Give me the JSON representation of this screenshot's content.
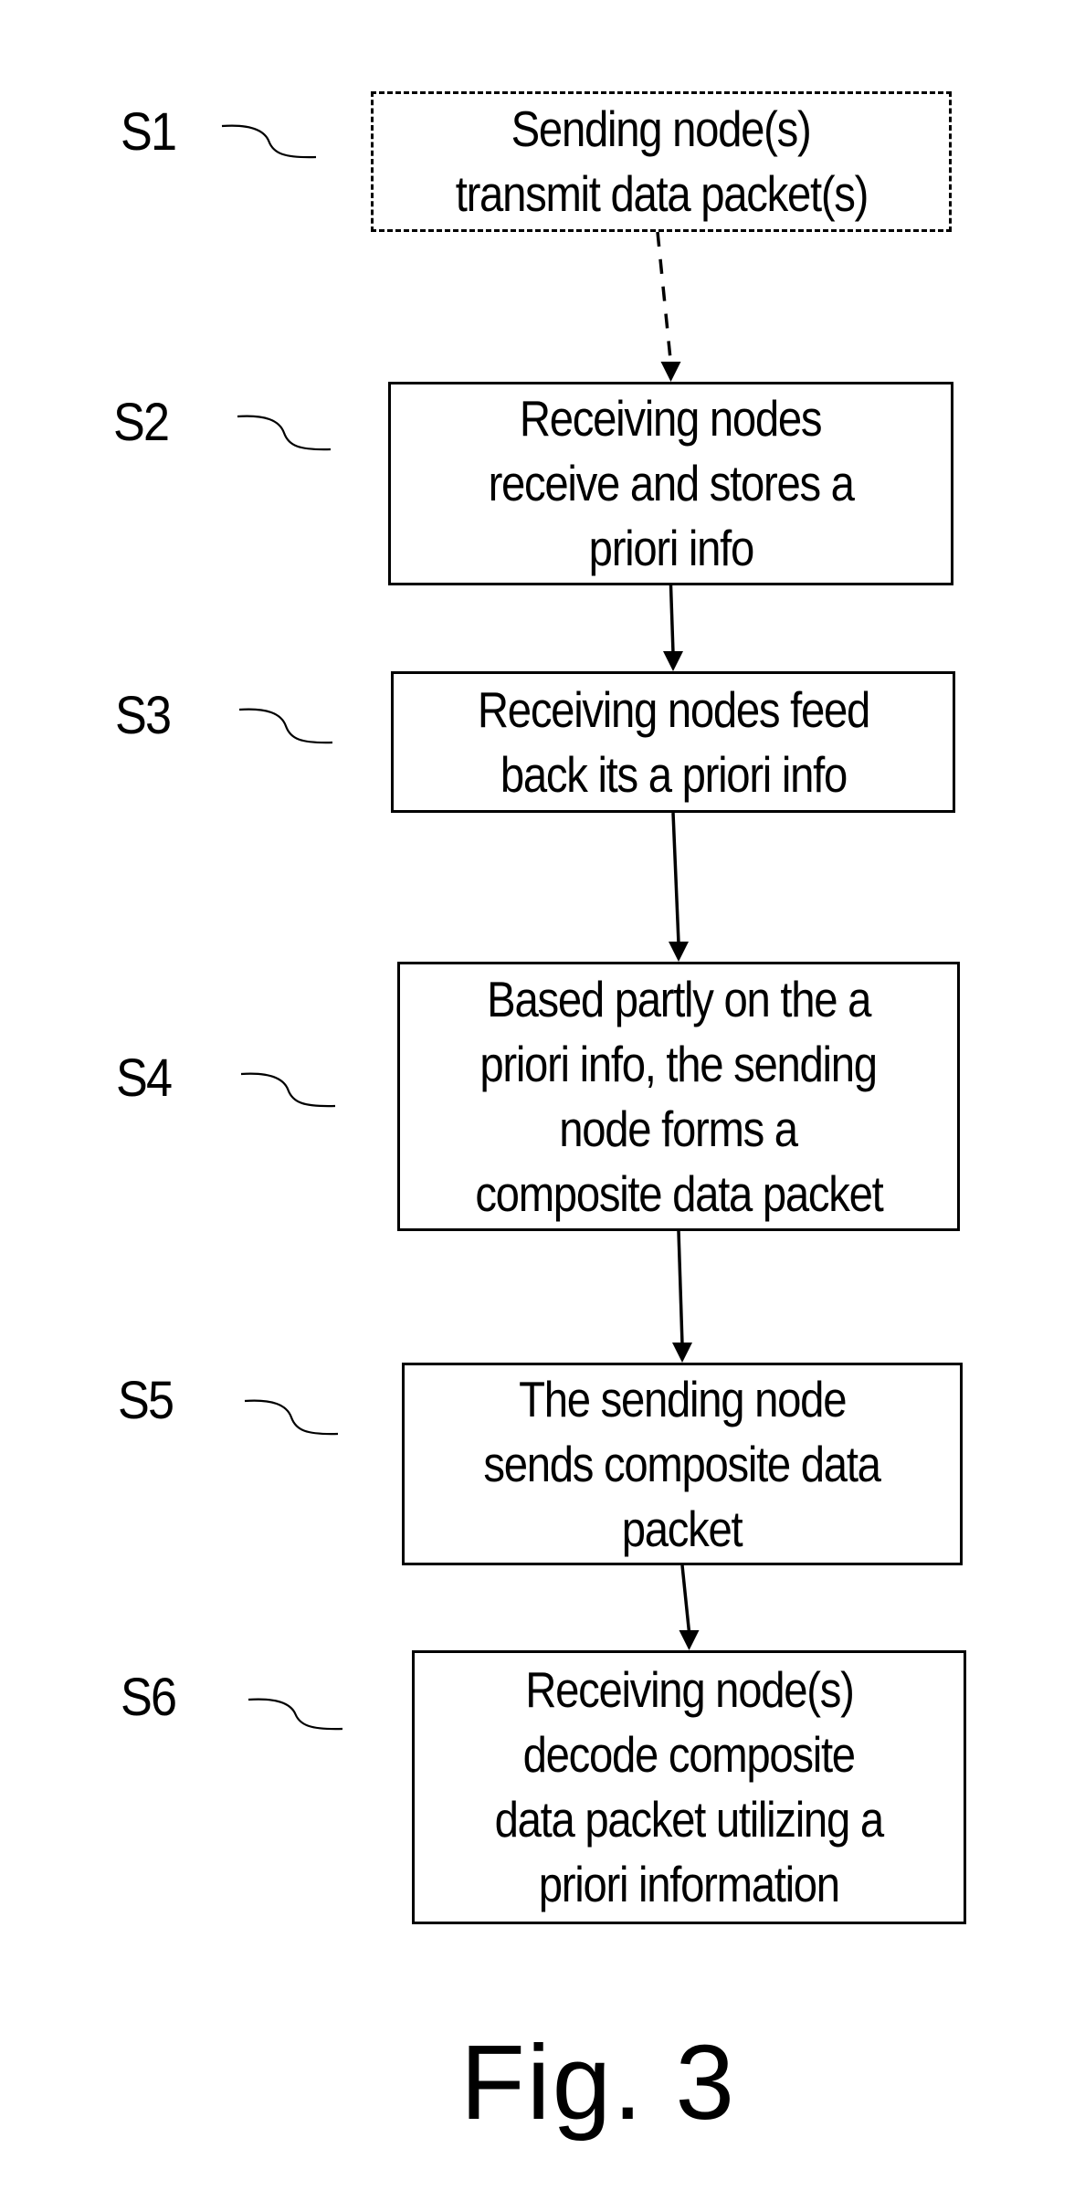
{
  "figure": {
    "caption": "Fig. 3",
    "steps": [
      {
        "id": "S1",
        "label": "S1",
        "style": "dashed",
        "lines": [
          "Sending node(s)",
          "transmit data packet(s)"
        ]
      },
      {
        "id": "S2",
        "label": "S2",
        "style": "solid",
        "lines": [
          "Receiving nodes",
          "receive and stores a",
          "priori info"
        ]
      },
      {
        "id": "S3",
        "label": "S3",
        "style": "solid",
        "lines": [
          "Receiving nodes feed",
          "back its a priori info"
        ]
      },
      {
        "id": "S4",
        "label": "S4",
        "style": "solid",
        "lines": [
          "Based partly on the a",
          "priori info, the sending",
          "node forms a",
          "composite data packet"
        ]
      },
      {
        "id": "S5",
        "label": "S5",
        "style": "solid",
        "lines": [
          "The sending node",
          "sends composite data",
          "packet"
        ]
      },
      {
        "id": "S6",
        "label": "S6",
        "style": "solid",
        "lines": [
          "Receiving node(s)",
          "decode composite",
          "data packet utilizing a",
          "priori information"
        ]
      }
    ],
    "connectors": [
      {
        "from": "S1",
        "to": "S2",
        "style": "dashed"
      },
      {
        "from": "S2",
        "to": "S3",
        "style": "solid"
      },
      {
        "from": "S3",
        "to": "S4",
        "style": "solid"
      },
      {
        "from": "S4",
        "to": "S5",
        "style": "solid"
      },
      {
        "from": "S5",
        "to": "S6",
        "style": "solid"
      }
    ]
  }
}
